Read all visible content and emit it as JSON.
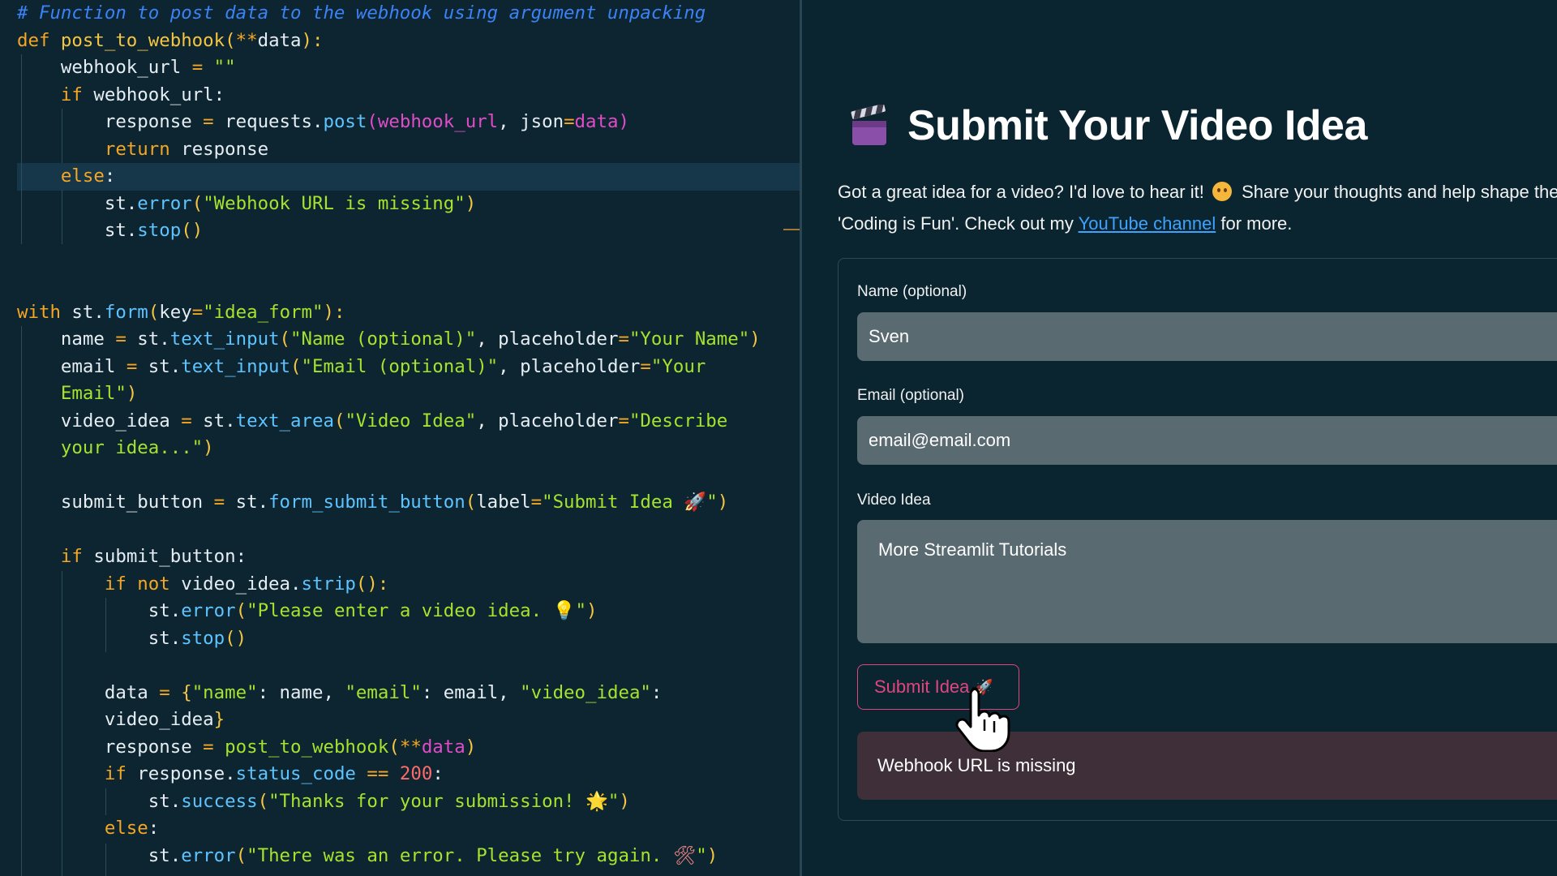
{
  "editor": {
    "lines": [
      [
        {
          "t": "# Function to post data to the webhook using argument unpacking",
          "c": "cm"
        }
      ],
      [
        {
          "t": "def ",
          "c": "kw"
        },
        {
          "t": "post_to_webhook",
          "c": "p1"
        },
        {
          "t": "(",
          "c": "p1"
        },
        {
          "t": "**",
          "c": "op"
        },
        {
          "t": "data"
        },
        {
          "t": "):",
          "c": "p1"
        }
      ],
      [
        {
          "t": "    webhook_url "
        },
        {
          "t": "=",
          "c": "op"
        },
        {
          "t": " \"\"",
          "c": "str"
        }
      ],
      [
        {
          "t": "    "
        },
        {
          "t": "if ",
          "c": "kw"
        },
        {
          "t": "webhook_url:"
        }
      ],
      [
        {
          "t": "        response "
        },
        {
          "t": "=",
          "c": "op"
        },
        {
          "t": " requests."
        },
        {
          "t": "post",
          "c": "fn"
        },
        {
          "t": "(",
          "c": "p2"
        },
        {
          "t": "webhook_url",
          "c": "var"
        },
        {
          "t": ", json"
        },
        {
          "t": "=",
          "c": "op"
        },
        {
          "t": "data",
          "c": "var"
        },
        {
          "t": ")",
          "c": "p2"
        }
      ],
      [
        {
          "t": "        "
        },
        {
          "t": "return ",
          "c": "kw"
        },
        {
          "t": "response"
        }
      ],
      [
        {
          "t": "    "
        },
        {
          "t": "else",
          "c": "kw"
        },
        {
          "t": ":"
        }
      ],
      [
        {
          "t": "        st."
        },
        {
          "t": "error",
          "c": "fn"
        },
        {
          "t": "(",
          "c": "p1"
        },
        {
          "t": "\"Webhook URL is missing\"",
          "c": "str"
        },
        {
          "t": ")",
          "c": "p1"
        }
      ],
      [
        {
          "t": "        st."
        },
        {
          "t": "stop",
          "c": "fn"
        },
        {
          "t": "()",
          "c": "p1"
        }
      ],
      [],
      [],
      [
        {
          "t": "with ",
          "c": "kw"
        },
        {
          "t": "st."
        },
        {
          "t": "form",
          "c": "fn"
        },
        {
          "t": "(",
          "c": "p1"
        },
        {
          "t": "key"
        },
        {
          "t": "=",
          "c": "op"
        },
        {
          "t": "\"idea_form\"",
          "c": "str"
        },
        {
          "t": "):",
          "c": "p1"
        }
      ],
      [
        {
          "t": "    name "
        },
        {
          "t": "=",
          "c": "op"
        },
        {
          "t": " st."
        },
        {
          "t": "text_input",
          "c": "fn"
        },
        {
          "t": "(",
          "c": "p1"
        },
        {
          "t": "\"Name (optional)\"",
          "c": "str"
        },
        {
          "t": ", placeholder"
        },
        {
          "t": "=",
          "c": "op"
        },
        {
          "t": "\"Your Name\"",
          "c": "str"
        },
        {
          "t": ")",
          "c": "p1"
        }
      ],
      [
        {
          "t": "    email "
        },
        {
          "t": "=",
          "c": "op"
        },
        {
          "t": " st."
        },
        {
          "t": "text_input",
          "c": "fn"
        },
        {
          "t": "(",
          "c": "p1"
        },
        {
          "t": "\"Email (optional)\"",
          "c": "str"
        },
        {
          "t": ", placeholder"
        },
        {
          "t": "=",
          "c": "op"
        },
        {
          "t": "\"Your",
          "c": "str"
        }
      ],
      [
        {
          "t": "    "
        },
        {
          "t": "Email\"",
          "c": "str"
        },
        {
          "t": ")",
          "c": "p1"
        }
      ],
      [
        {
          "t": "    video_idea "
        },
        {
          "t": "=",
          "c": "op"
        },
        {
          "t": " st."
        },
        {
          "t": "text_area",
          "c": "fn"
        },
        {
          "t": "(",
          "c": "p1"
        },
        {
          "t": "\"Video Idea\"",
          "c": "str"
        },
        {
          "t": ", placeholder"
        },
        {
          "t": "=",
          "c": "op"
        },
        {
          "t": "\"Describe",
          "c": "str"
        }
      ],
      [
        {
          "t": "    "
        },
        {
          "t": "your idea...\"",
          "c": "str"
        },
        {
          "t": ")",
          "c": "p1"
        }
      ],
      [],
      [
        {
          "t": "    submit_button "
        },
        {
          "t": "=",
          "c": "op"
        },
        {
          "t": " st."
        },
        {
          "t": "form_submit_button",
          "c": "fn"
        },
        {
          "t": "(",
          "c": "p1"
        },
        {
          "t": "label"
        },
        {
          "t": "=",
          "c": "op"
        },
        {
          "t": "\"Submit Idea ",
          "c": "str"
        },
        {
          "t": "🚀",
          "c": "emo"
        },
        {
          "t": "\"",
          "c": "str"
        },
        {
          "t": ")",
          "c": "p1"
        }
      ],
      [],
      [
        {
          "t": "    "
        },
        {
          "t": "if ",
          "c": "kw"
        },
        {
          "t": "submit_button:"
        }
      ],
      [
        {
          "t": "        "
        },
        {
          "t": "if not ",
          "c": "kw"
        },
        {
          "t": "video_idea."
        },
        {
          "t": "strip",
          "c": "fn"
        },
        {
          "t": "():",
          "c": "p1"
        }
      ],
      [
        {
          "t": "            st."
        },
        {
          "t": "error",
          "c": "fn"
        },
        {
          "t": "(",
          "c": "p1"
        },
        {
          "t": "\"Please enter a video idea. ",
          "c": "str"
        },
        {
          "t": "💡",
          "c": "p1"
        },
        {
          "t": "\"",
          "c": "str"
        },
        {
          "t": ")",
          "c": "p1"
        }
      ],
      [
        {
          "t": "            st."
        },
        {
          "t": "stop",
          "c": "fn"
        },
        {
          "t": "()",
          "c": "p1"
        }
      ],
      [],
      [
        {
          "t": "        data "
        },
        {
          "t": "=",
          "c": "op"
        },
        {
          "t": " "
        },
        {
          "t": "{",
          "c": "p1"
        },
        {
          "t": "\"name\"",
          "c": "str"
        },
        {
          "t": ": name, "
        },
        {
          "t": "\"email\"",
          "c": "str"
        },
        {
          "t": ": email, "
        },
        {
          "t": "\"video_idea\"",
          "c": "str"
        },
        {
          "t": ":"
        }
      ],
      [
        {
          "t": "        video_idea"
        },
        {
          "t": "}",
          "c": "p1"
        }
      ],
      [
        {
          "t": "        response "
        },
        {
          "t": "=",
          "c": "op"
        },
        {
          "t": " "
        },
        {
          "t": "post_to_webhook",
          "c": "str"
        },
        {
          "t": "(",
          "c": "p1"
        },
        {
          "t": "**",
          "c": "op"
        },
        {
          "t": "data",
          "c": "var"
        },
        {
          "t": ")",
          "c": "p1"
        }
      ],
      [
        {
          "t": "        "
        },
        {
          "t": "if ",
          "c": "kw"
        },
        {
          "t": "response."
        },
        {
          "t": "status_code",
          "c": "fn"
        },
        {
          "t": " "
        },
        {
          "t": "==",
          "c": "op"
        },
        {
          "t": " "
        },
        {
          "t": "200",
          "c": "num"
        },
        {
          "t": ":"
        }
      ],
      [
        {
          "t": "            st."
        },
        {
          "t": "success",
          "c": "fn"
        },
        {
          "t": "(",
          "c": "p1"
        },
        {
          "t": "\"Thanks for your submission! ",
          "c": "str"
        },
        {
          "t": "🌟",
          "c": "p1"
        },
        {
          "t": "\"",
          "c": "str"
        },
        {
          "t": ")",
          "c": "p1"
        }
      ],
      [
        {
          "t": "        "
        },
        {
          "t": "else",
          "c": "kw"
        },
        {
          "t": ":"
        }
      ],
      [
        {
          "t": "            st."
        },
        {
          "t": "error",
          "c": "fn"
        },
        {
          "t": "(",
          "c": "p1"
        },
        {
          "t": "\"There was an error. Please try again. ",
          "c": "str"
        },
        {
          "t": "🛠",
          "c": "emo"
        },
        {
          "t": "\"",
          "c": "str"
        },
        {
          "t": ")",
          "c": "p1"
        }
      ]
    ]
  },
  "app": {
    "title": "Submit Your Video Idea",
    "intro_part1": "Got a great idea for a video? I'd love to hear it!",
    "intro_part2": "Share your thoughts and help shape the",
    "intro_part3": "'Coding is Fun'. Check out my",
    "intro_link": "YouTube channel",
    "intro_part4": "for more.",
    "form": {
      "name_label": "Name (optional)",
      "name_value": "Sven",
      "email_label": "Email (optional)",
      "email_value": "email@email.com",
      "idea_label": "Video Idea",
      "idea_value": "More Streamlit Tutorials",
      "submit_label": "Submit Idea",
      "submit_emoji": "🚀"
    },
    "error_message": "Webhook URL is missing"
  },
  "colors": {
    "background": "#0b2530",
    "accent": "#e0457f",
    "link": "#3ea2ff",
    "input_bg": "#5a6a71",
    "error_bg": "#3e2f38"
  },
  "icons": {
    "title_icon": "clapperboard-icon",
    "intro_emoji": "face-emoji-icon",
    "submit_icon": "rocket-icon",
    "cursor": "hand-pointer-icon"
  }
}
